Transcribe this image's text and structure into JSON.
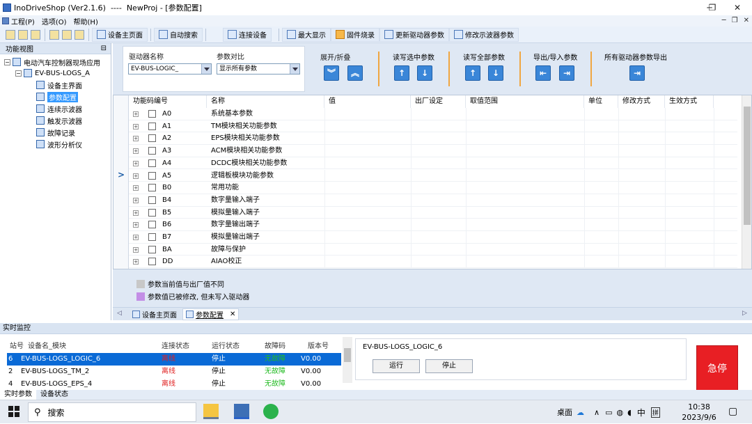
{
  "window": {
    "title": "InoDriveShop (Ver2.1.6)  ----  NewProj - [参数配置]",
    "min": "─",
    "max": "❐",
    "close": "✕"
  },
  "menu": {
    "items": [
      "工程(P)",
      "选项(O)",
      "帮助(H)"
    ],
    "right": [
      "─",
      "❐",
      "✕"
    ]
  },
  "toolbar": {
    "buttons": [
      "设备主页面",
      "自动搜索",
      "连接设备",
      "最大显示",
      "固件烧录",
      "更新驱动器参数",
      "修改示波器参数"
    ]
  },
  "left": {
    "title": "功能视图",
    "pin": "⊟",
    "tree": {
      "root": "电动汽车控制器现场应用",
      "device": "EV-BUS-LOGS_A",
      "children": [
        "设备主界面",
        "参数配置",
        "连续示波器",
        "触发示波器",
        "故障记录",
        "波形分析仪"
      ],
      "selected": 1
    }
  },
  "params": {
    "driver_label": "驱动器名称",
    "driver_value": "EV-BUS-LOGIC_",
    "compare_label": "参数对比",
    "compare_value": "显示所有参数",
    "expand_label": "展开/折叠",
    "read_sel_label": "读写选中参数",
    "read_all_label": "读写全部参数",
    "import_label": "导出/导入参数",
    "export_all_label": "所有驱动器参数导出"
  },
  "grid": {
    "columns": [
      "功能码编号",
      "名称",
      "值",
      "出厂设定",
      "取值范围",
      "单位",
      "修改方式",
      "生效方式"
    ],
    "rows": [
      [
        "A0",
        "系统基本参数"
      ],
      [
        "A1",
        "TM模块相关功能参数"
      ],
      [
        "A2",
        "EPS模块相关功能参数"
      ],
      [
        "A3",
        "ACM模块相关功能参数"
      ],
      [
        "A4",
        "DCDC模块相关功能参数"
      ],
      [
        "A5",
        "逻辑板模块功能参数"
      ],
      [
        "B0",
        "常用功能"
      ],
      [
        "B4",
        "数字量输入端子"
      ],
      [
        "B5",
        "模拟量输入端子"
      ],
      [
        "B6",
        "数字量输出端子"
      ],
      [
        "B7",
        "模拟量输出端子"
      ],
      [
        "BA",
        "故障与保护"
      ],
      [
        "DD",
        "AIAO校正"
      ]
    ],
    "current_row": 5
  },
  "legend": [
    {
      "color": "#c8c8c8",
      "text": "参数当前值与出厂值不同"
    },
    {
      "color": "#c38ee6",
      "text": "参数值已被修改, 但未写入驱动器"
    }
  ],
  "doctabs": [
    "设备主页面",
    "参数配置"
  ],
  "monitor": {
    "title": "实时监控",
    "columns": [
      "站号",
      "设备名_模块",
      "连接状态",
      "运行状态",
      "故障码",
      "版本号"
    ],
    "rows": [
      [
        "6",
        "EV-BUS-LOGS_LOGIC_6",
        "离线",
        "停止",
        "无故障",
        "V0.00"
      ],
      [
        "2",
        "EV-BUS-LOGS_TM_2",
        "离线",
        "停止",
        "无故障",
        "V0.00"
      ],
      [
        "4",
        "EV-BUS-LOGS_EPS_4",
        "离线",
        "停止",
        "无故障",
        "V0.00"
      ]
    ],
    "selected": 0,
    "device_name": "EV-BUS-LOGS_LOGIC_6",
    "run": "运行",
    "stop": "停止",
    "estop": "急停",
    "offline_color": "#e02020",
    "ok_color": "#22bb22"
  },
  "bottom_tabs": [
    "实时参数",
    "设备状态"
  ],
  "taskbar": {
    "search": "搜索",
    "desktop": "桌面",
    "time": "10:38",
    "date": "2023/9/6",
    "ime": "中",
    "ime2": "拼"
  }
}
